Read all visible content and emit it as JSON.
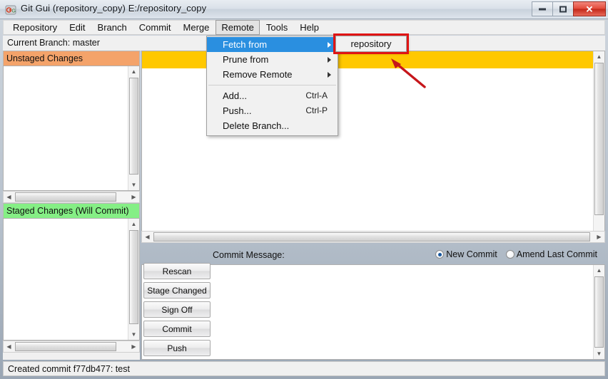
{
  "window": {
    "title": "Git Gui (repository_copy) E:/repository_copy",
    "icon": "git-logo-icon",
    "controls": {
      "minimize": "minimize-icon",
      "maximize": "maximize-icon",
      "close": "✕"
    }
  },
  "menubar": {
    "items": [
      {
        "label": "Repository",
        "active": false
      },
      {
        "label": "Edit",
        "active": false
      },
      {
        "label": "Branch",
        "active": false
      },
      {
        "label": "Commit",
        "active": false
      },
      {
        "label": "Merge",
        "active": false
      },
      {
        "label": "Remote",
        "active": true
      },
      {
        "label": "Tools",
        "active": false
      },
      {
        "label": "Help",
        "active": false
      }
    ]
  },
  "branch": {
    "text": "Current Branch: master"
  },
  "panels": {
    "unstaged": {
      "title": "Unstaged Changes",
      "color": "#f4a36a",
      "items": []
    },
    "staged": {
      "title": "Staged Changes (Will Commit)",
      "color": "#85ef85",
      "items": []
    }
  },
  "main": {
    "highlight_color": "#ffc800",
    "content": ""
  },
  "commit": {
    "label": "Commit Message:",
    "new_commit_label": "New Commit",
    "amend_label": "Amend Last Commit",
    "selected": "New Commit",
    "message": ""
  },
  "buttons": [
    {
      "label": "Rescan"
    },
    {
      "label": "Stage Changed"
    },
    {
      "label": "Sign Off"
    },
    {
      "label": "Commit"
    },
    {
      "label": "Push"
    }
  ],
  "status": {
    "text": "Created commit f77db477: test"
  },
  "dropdown": {
    "open_menu": "Remote",
    "items": [
      {
        "label": "Fetch from",
        "shortcut": "",
        "submenu": true,
        "highlighted": true,
        "separator_after": false
      },
      {
        "label": "Prune from",
        "shortcut": "",
        "submenu": true,
        "highlighted": false,
        "separator_after": false
      },
      {
        "label": "Remove Remote",
        "shortcut": "",
        "submenu": true,
        "highlighted": false,
        "separator_after": true
      },
      {
        "label": "Add...",
        "shortcut": "Ctrl-A",
        "submenu": false,
        "highlighted": false,
        "separator_after": false
      },
      {
        "label": "Push...",
        "shortcut": "Ctrl-P",
        "submenu": false,
        "highlighted": false,
        "separator_after": false
      },
      {
        "label": "Delete Branch...",
        "shortcut": "",
        "submenu": false,
        "highlighted": false,
        "separator_after": false
      }
    ]
  },
  "submenu": {
    "items": [
      {
        "label": "repository"
      }
    ]
  },
  "annotation": {
    "color": "#e01414",
    "box_target": "repository",
    "arrow": "red-arrow-annotation"
  }
}
